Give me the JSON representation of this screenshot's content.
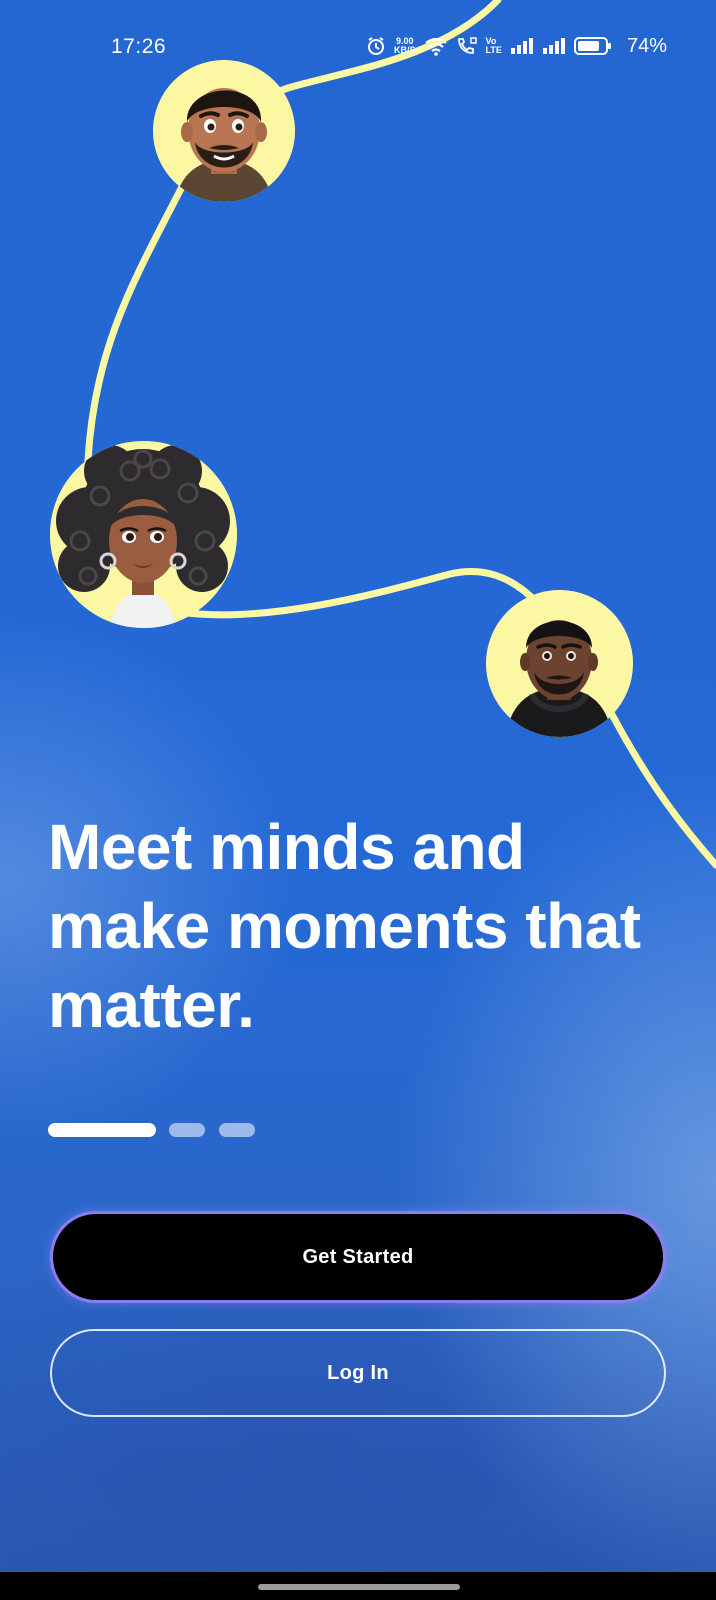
{
  "status_bar": {
    "time": "17:26",
    "net_speed_value": "9.00",
    "net_speed_unit": "KB/S",
    "volte_top": "Vo",
    "volte_bottom": "LTE",
    "battery_percent": "74%"
  },
  "onboarding": {
    "headline": "Meet minds and make moments that matter.",
    "page_indicator": {
      "total": 3,
      "active": 1
    }
  },
  "actions": {
    "primary_label": "Get Started",
    "secondary_label": "Log In"
  },
  "colors": {
    "background": "#2569d6",
    "path_line": "#fbf7a2",
    "avatar_ring": "#fbf7a2",
    "primary_button": "#000000",
    "primary_button_border": "#8d7cf0"
  },
  "avatars": [
    {
      "icon": "avatar-man-beard-icon"
    },
    {
      "icon": "avatar-woman-curly-hair-icon"
    },
    {
      "icon": "avatar-man-hoodie-icon"
    }
  ]
}
